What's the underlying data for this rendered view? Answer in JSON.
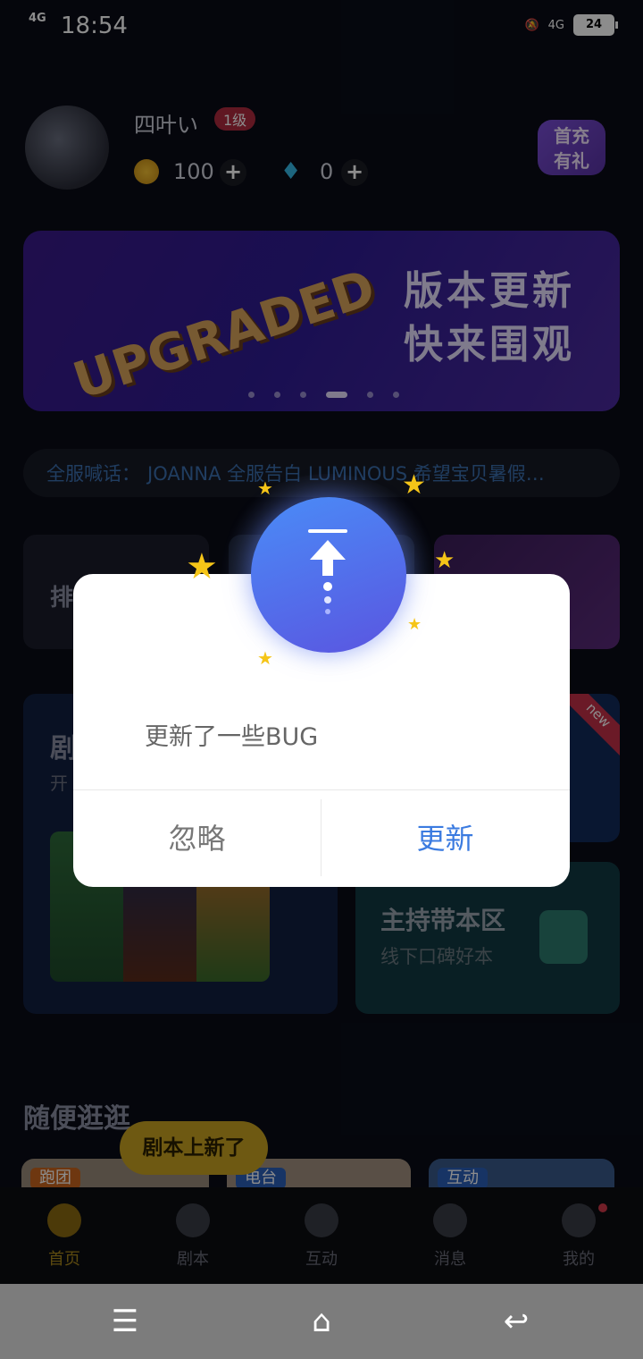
{
  "status_bar": {
    "network": "4G",
    "time": "18:54",
    "network_right": "4G",
    "battery": "24"
  },
  "profile": {
    "username": "四叶い",
    "level": "1级",
    "coins": "100",
    "gems": "0",
    "first_charge": "首充\n有礼"
  },
  "banner": {
    "word": "UPGRADED",
    "title_line1": "版本更新",
    "title_line2": "快来围观"
  },
  "broadcast": {
    "label": "全服喊话：",
    "message": "JOANNA 全服告白 LUMINOUS 希望宝贝暑假…"
  },
  "cards": {
    "rank_label": "排",
    "script_title": "剧",
    "script_sub": "开",
    "new_badge": "new",
    "host_title": "主持带本区",
    "host_sub": "线下口碑好本"
  },
  "browse": {
    "title": "随便逛逛",
    "tooltip": "剧本上新了",
    "tags": [
      "跑团",
      "电台",
      "互动"
    ]
  },
  "tabs": [
    {
      "label": "首页",
      "icon": "home-icon"
    },
    {
      "label": "剧本",
      "icon": "book-icon"
    },
    {
      "label": "互动",
      "icon": "compass-icon"
    },
    {
      "label": "消息",
      "icon": "chat-icon"
    },
    {
      "label": "我的",
      "icon": "profile-icon"
    }
  ],
  "dialog": {
    "message": "更新了一些BUG",
    "ignore_label": "忽略",
    "update_label": "更新",
    "icon": "upload-arrow-icon"
  },
  "colors": {
    "accent": "#3b7be0",
    "tab_active": "#a8871c",
    "tooltip": "#c8a222"
  }
}
